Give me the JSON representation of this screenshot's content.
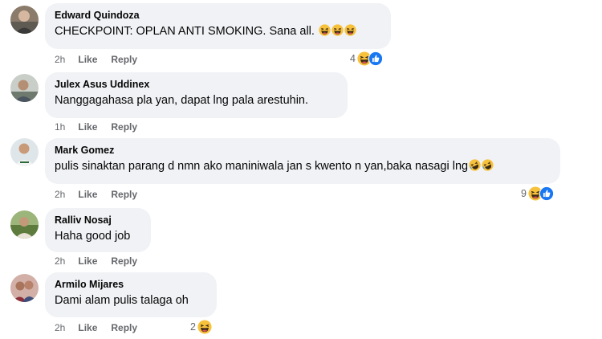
{
  "comments": [
    {
      "author": "Edward Quindoza",
      "text": "CHECKPOINT: OPLAN ANTI SMOKING. Sana all.",
      "inline_emojis": [
        "haha",
        "haha",
        "haha"
      ],
      "time": "2h",
      "like": "Like",
      "reply": "Reply",
      "reaction_count": "4",
      "reactions": [
        "haha",
        "like"
      ],
      "avatar_color": "#8a7b6a"
    },
    {
      "author": "Julex Asus Uddinex",
      "text": "Nanggagahasa pla yan, dapat lng pala arestuhin.",
      "inline_emojis": [],
      "time": "1h",
      "like": "Like",
      "reply": "Reply",
      "reaction_count": "",
      "reactions": [],
      "avatar_color": "#9aa39a"
    },
    {
      "author": "Mark Gomez",
      "text": "pulis sinaktan parang d nmn ako maniniwala jan s kwento n yan,baka nasagi lng",
      "inline_emojis": [
        "rofl",
        "rofl"
      ],
      "time": "2h",
      "like": "Like",
      "reply": "Reply",
      "reaction_count": "9",
      "reactions": [
        "haha",
        "like"
      ],
      "avatar_color": "#b8c4cc"
    },
    {
      "author": "Ralliv Nosaj",
      "text": "Haha good job",
      "inline_emojis": [],
      "time": "2h",
      "like": "Like",
      "reply": "Reply",
      "reaction_count": "",
      "reactions": [],
      "avatar_color": "#7d9a5a"
    },
    {
      "author": "Armilo Mijares",
      "text": "Dami alam pulis talaga oh",
      "inline_emojis": [],
      "time": "2h",
      "like": "Like",
      "reply": "Reply",
      "reaction_count": "2",
      "reactions": [
        "haha"
      ],
      "avatar_color": "#a06a6a"
    }
  ],
  "colors": {
    "bubble": "#f0f2f5",
    "meta": "#65676b",
    "like_blue": "#1877f2",
    "haha_yellow": "#f7c13b"
  }
}
